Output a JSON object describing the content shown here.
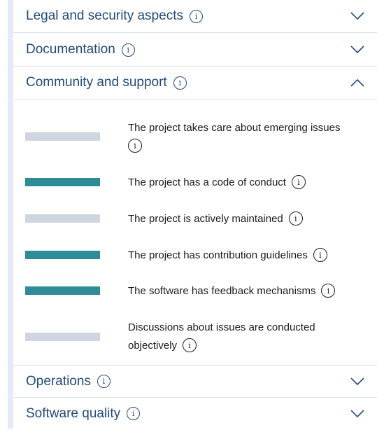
{
  "sections": [
    {
      "title": "Legal and security aspects",
      "expanded": false
    },
    {
      "title": "Documentation",
      "expanded": false
    },
    {
      "title": "Community and support",
      "expanded": true
    },
    {
      "title": "Operations",
      "expanded": false
    },
    {
      "title": "Software quality",
      "expanded": false
    }
  ],
  "community_items": [
    {
      "text": "The project takes care about emerging issues",
      "fulfilled": false
    },
    {
      "text": "The project has a code of conduct",
      "fulfilled": true
    },
    {
      "text": "The project is actively maintained",
      "fulfilled": false
    },
    {
      "text": "The project has contribution guidelines",
      "fulfilled": true
    },
    {
      "text": "The software has feedback mechanisms",
      "fulfilled": true
    },
    {
      "text": "Discussions about issues are conducted objectively",
      "fulfilled": false
    }
  ],
  "icons": {
    "info": "info-icon",
    "collapsed": "chevron-down-icon",
    "expanded": "chevron-up-icon"
  },
  "colors": {
    "fulfilled": "#2e8c98",
    "unfulfilled": "#cfd6e2",
    "heading": "#234a7a"
  }
}
